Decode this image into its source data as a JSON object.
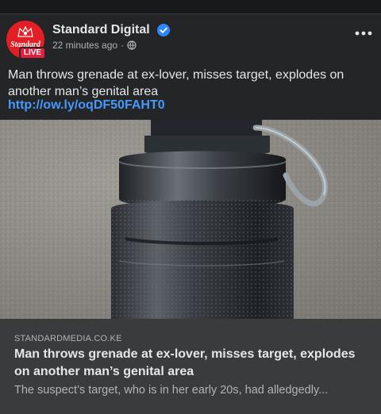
{
  "post": {
    "page_name": "Standard Digital",
    "timestamp": "22 minutes ago",
    "separator": "·",
    "avatar_text": "Standard",
    "live_badge": "LIVE",
    "text": "Man throws grenade at ex-lover, misses target, explodes on another man’s genital area",
    "link": "http://ow.ly/oqDF50FAHT0",
    "icons": {
      "verified": "verified-badge-icon",
      "audience": "globe-icon",
      "more": "more-horizontal-icon"
    },
    "colors": {
      "brand_red": "#e31e24",
      "link_blue": "#4599ff",
      "verified_blue": "#2d88ff"
    }
  },
  "link_preview": {
    "domain": "STANDARDMEDIA.CO.KE",
    "title": "Man throws grenade at ex-lover, misses target, explodes on another man’s genital area",
    "description": "The suspect’s target, who is in her early 20s, had alledgedly..."
  }
}
